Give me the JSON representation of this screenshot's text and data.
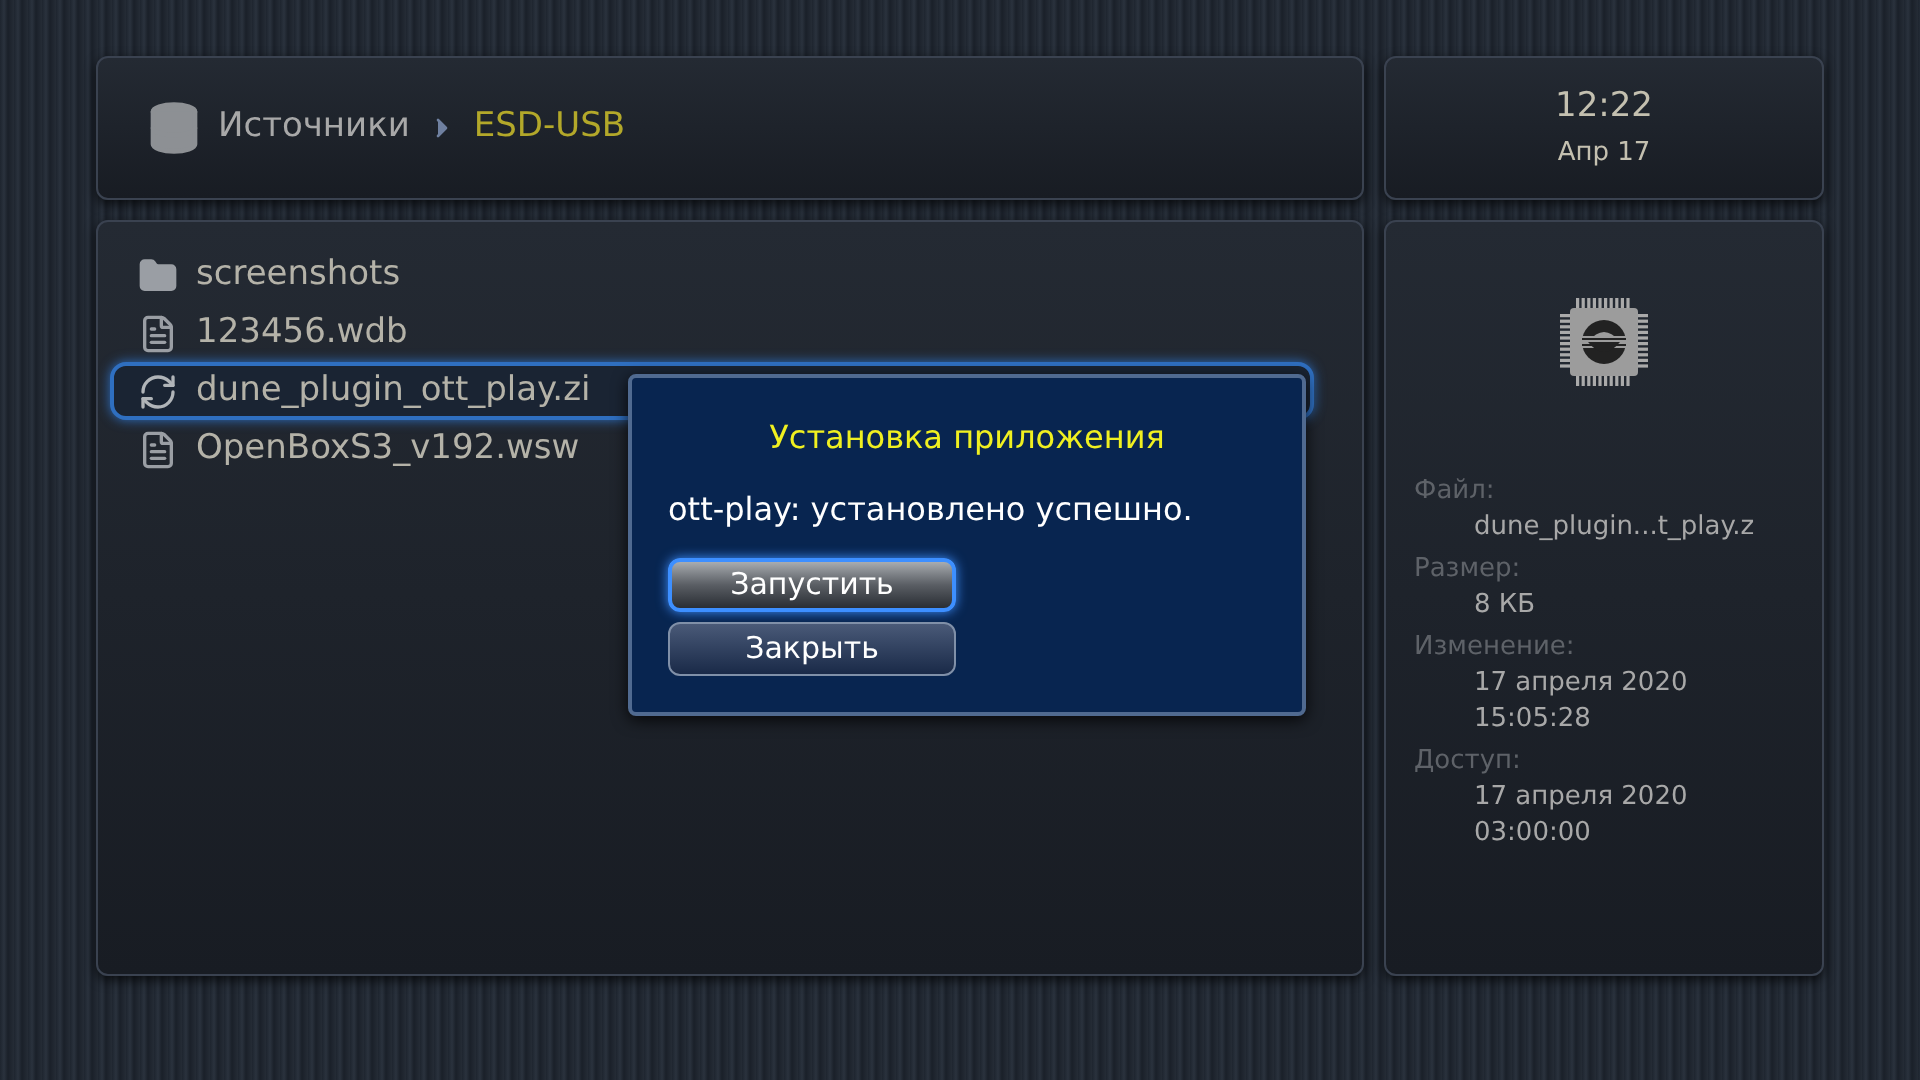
{
  "breadcrumb": [
    {
      "label": "Источники",
      "current": false
    },
    {
      "label": "ESD-USB",
      "current": true
    }
  ],
  "clock": {
    "time": "12:22",
    "date": "Апр 17"
  },
  "files": [
    {
      "name": "screenshots",
      "kind": "folder",
      "selected": false
    },
    {
      "name": "123456.wdb",
      "kind": "file",
      "selected": false
    },
    {
      "name": "dune_plugin_ott_play.zi",
      "kind": "plugin",
      "selected": true
    },
    {
      "name": "OpenBoxS3_v192.wsw",
      "kind": "file",
      "selected": false
    }
  ],
  "info": [
    {
      "label": "Файл:",
      "values": [
        "dune_plugin...t_play.z"
      ]
    },
    {
      "label": "Размер:",
      "values": [
        "8 КБ"
      ]
    },
    {
      "label": "Изменение:",
      "values": [
        "17 апреля 2020",
        "15:05:28"
      ]
    },
    {
      "label": "Доступ:",
      "values": [
        "17 апреля 2020",
        "03:00:00"
      ]
    }
  ],
  "dialog": {
    "title": "Установка приложения",
    "message": "ott-play: установлено успешно.",
    "buttons": [
      {
        "label": "Запустить",
        "selected": true
      },
      {
        "label": "Закрыть",
        "selected": false
      }
    ]
  }
}
